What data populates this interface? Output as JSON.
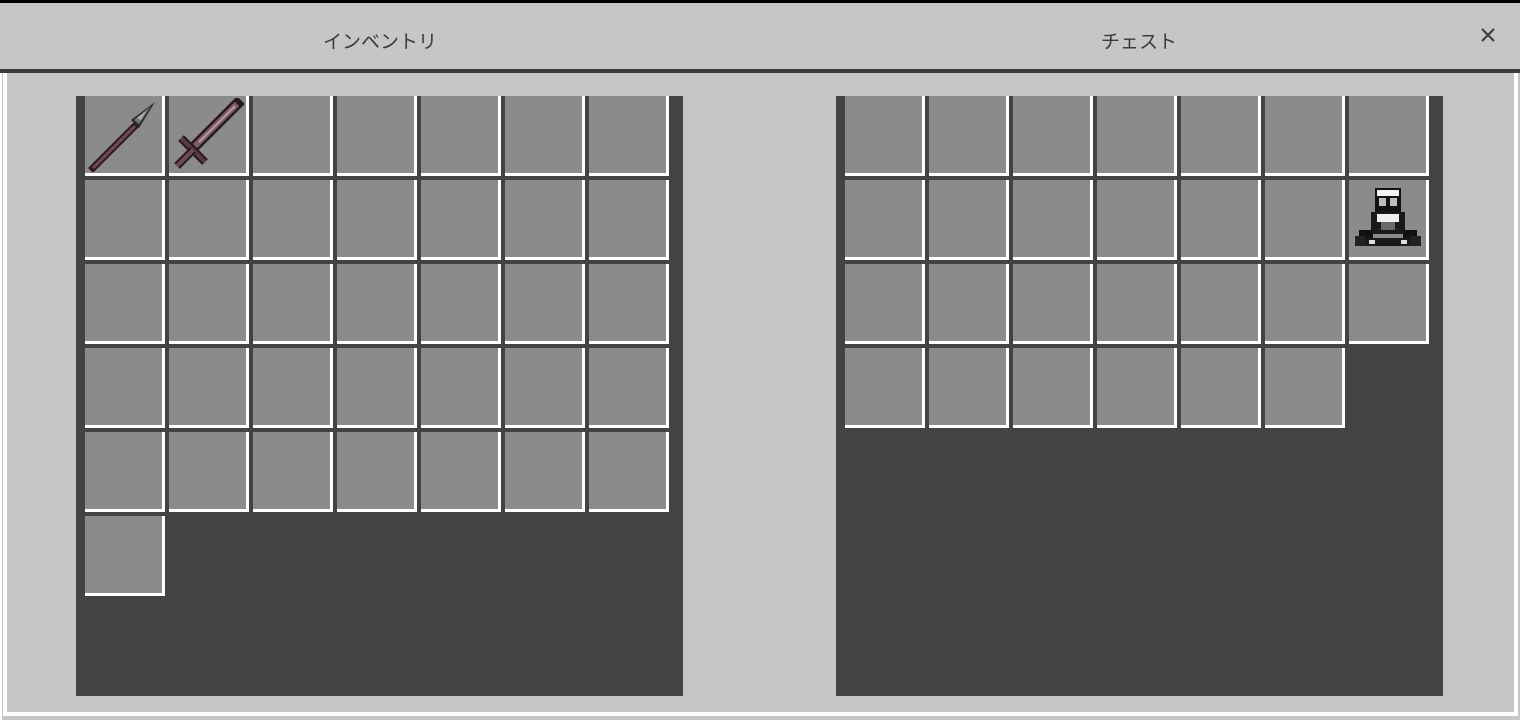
{
  "header": {
    "inventory_title": "インベントリ",
    "chest_title": "チェスト",
    "close_icon": "close-icon"
  },
  "inventory": {
    "slot_count": 36,
    "items": [
      {
        "slot": 0,
        "icon": "spear-icon",
        "name": ""
      },
      {
        "slot": 1,
        "icon": "sword-icon",
        "name": ""
      }
    ]
  },
  "chest": {
    "slot_count": 27,
    "items": [
      {
        "slot": 13,
        "icon": "creature-icon",
        "name": ""
      }
    ]
  },
  "colors": {
    "background": "#c6c6c6",
    "panel": "#434343",
    "slot": "#8b8b8b",
    "slot_highlight": "#ffffff"
  }
}
